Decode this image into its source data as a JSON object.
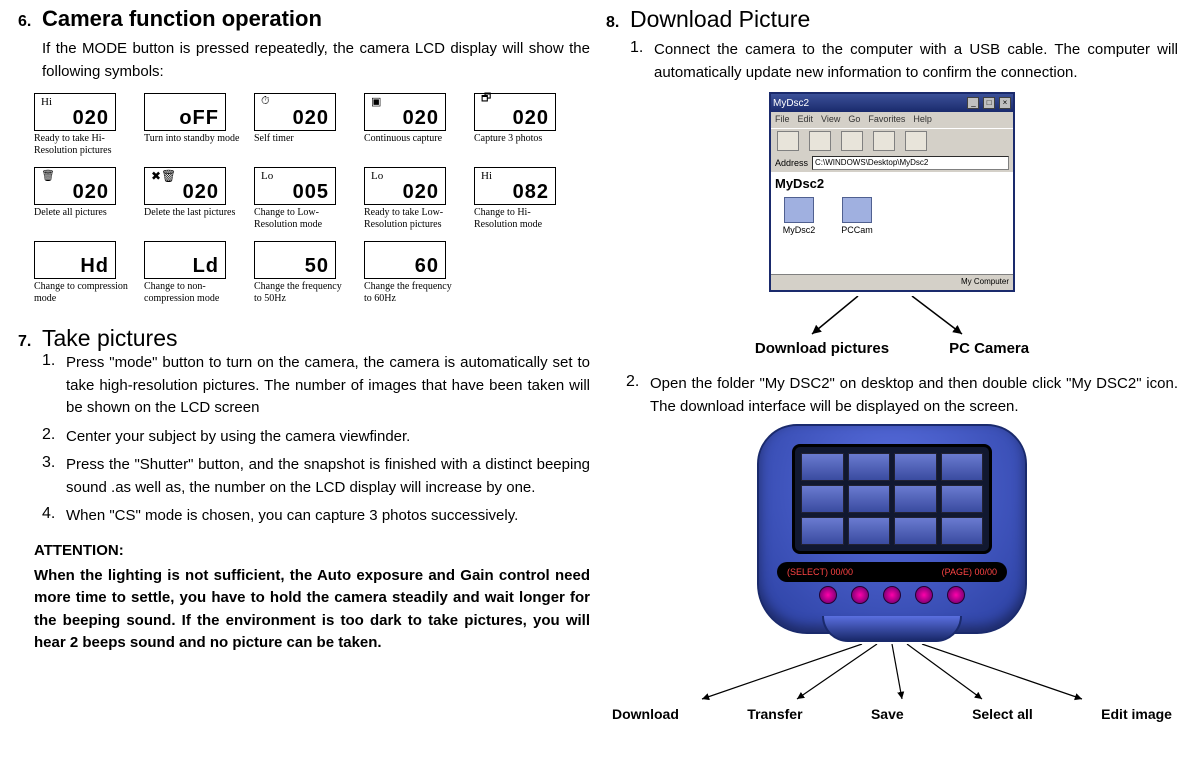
{
  "left": {
    "sec6_num": "6.",
    "sec6_title": "Camera function operation",
    "sec6_intro": "If the MODE button is pressed repeatedly, the camera LCD display will show the following symbols:",
    "lcds": [
      {
        "top": "Hi",
        "main": "020",
        "caption": "Ready to take Hi-Resolution pictures"
      },
      {
        "top": "",
        "main": "oFF",
        "caption": "Turn into standby mode"
      },
      {
        "top": "⏱",
        "main": "020",
        "caption": "Self timer"
      },
      {
        "top": "▣",
        "main": "020",
        "caption": "Continuous capture"
      },
      {
        "top": "🗗",
        "main": "020",
        "caption": "Capture 3 photos"
      },
      {
        "top": "🗑",
        "main": "020",
        "caption": "Delete all pictures"
      },
      {
        "top": "✖🗑",
        "main": "020",
        "caption": "Delete the last pictures"
      },
      {
        "top": "Lo",
        "main": "005",
        "caption": "Change to Low-Resolution mode"
      },
      {
        "top": "Lo",
        "main": "020",
        "caption": "Ready to take Low-Resolution pictures"
      },
      {
        "top": "Hi",
        "main": "082",
        "caption": "Change to Hi-Resolution mode"
      },
      {
        "top": "",
        "main": "Hd",
        "caption": "Change to compression mode"
      },
      {
        "top": "",
        "main": "Ld",
        "caption": "Change to non-compression mode"
      },
      {
        "top": "",
        "main": "50",
        "caption": "Change the frequency to 50Hz"
      },
      {
        "top": "",
        "main": "60",
        "caption": "Change the frequency to 60Hz"
      }
    ],
    "sec7_num": "7.",
    "sec7_title": "Take pictures",
    "steps7": [
      {
        "n": "1.",
        "t": "Press \"mode\" button to turn on the camera, the camera is automatically set to take high-resolution pictures. The number of images that have been taken will be shown on the LCD screen"
      },
      {
        "n": "2.",
        "t": "Center your subject by using the camera viewfinder."
      },
      {
        "n": "3.",
        "t": "Press the \"Shutter\" button, and the snapshot is finished with a distinct beeping sound .as well as, the number on the LCD display will increase by one."
      },
      {
        "n": "4.",
        "t": "When \"CS\" mode is chosen, you can capture 3 photos successively."
      }
    ],
    "attention_h": "ATTENTION:",
    "attention_b": "When the lighting is not sufficient, the Auto exposure and Gain control need more time to settle, you have to hold the camera steadily and wait longer for the beeping sound. If the environment is too dark to take pictures, you will hear 2 beeps sound and no picture can be taken."
  },
  "right": {
    "sec8_num": "8.",
    "sec8_title": "Download Picture",
    "step1_n": "1.",
    "step1_t": "Connect the camera to the computer with a USB cable. The computer will automatically update new information to confirm the connection.",
    "explorer": {
      "title": "MyDsc2",
      "menus": [
        "File",
        "Edit",
        "View",
        "Go",
        "Favorites",
        "Help"
      ],
      "address_label": "Address",
      "address_value": "C:\\WINDOWS\\Desktop\\MyDsc2",
      "panel_header": "MyDsc2",
      "icons": [
        "MyDsc2",
        "PCCam"
      ],
      "status": "My Computer"
    },
    "labels_top": [
      "Download pictures",
      "PC Camera"
    ],
    "step2_n": "2.",
    "step2_t": "Open the folder \"My DSC2\" on desktop and then double click \"My DSC2\" icon. The download interface will be displayed on the screen.",
    "device_bar": {
      "left": "(SELECT) 00/00",
      "right": "(PAGE) 00/00"
    },
    "labels_bottom": [
      "Download",
      "Transfer",
      "Save",
      "Select all",
      "Edit image"
    ]
  }
}
